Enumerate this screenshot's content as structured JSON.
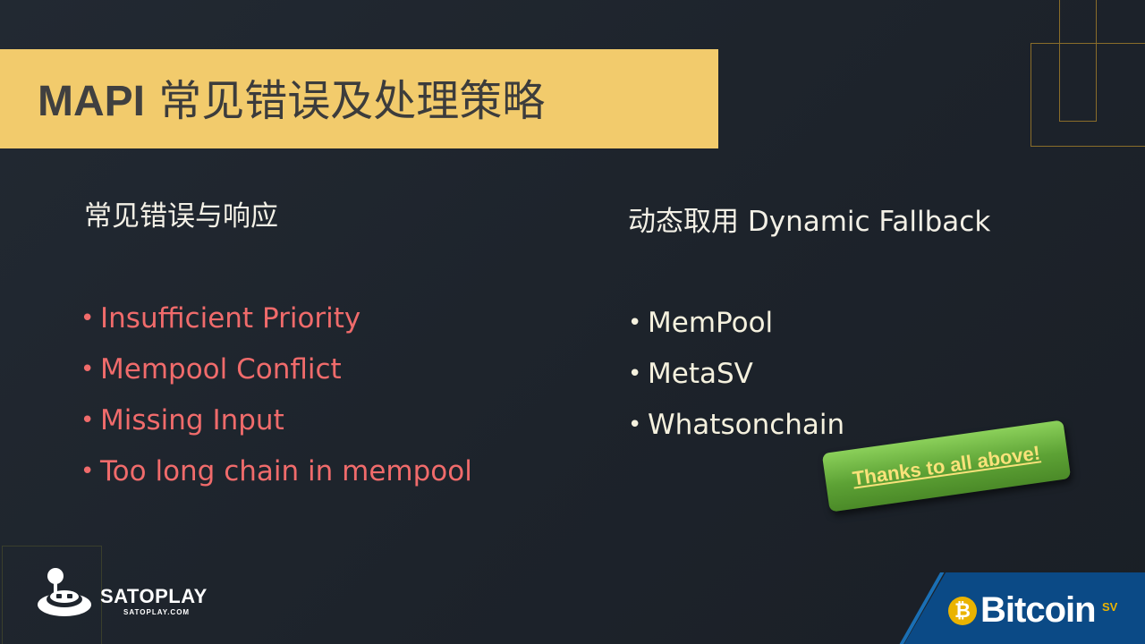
{
  "slide": {
    "title_bold": "MAPI",
    "title_rest": "常见错误及处理策略"
  },
  "left_column": {
    "heading": "常见错误与响应",
    "items": [
      {
        "label": "Insufficient Priority"
      },
      {
        "label": "Mempool Conflict"
      },
      {
        "label": "Missing Input"
      },
      {
        "label": "Too long chain in mempool"
      }
    ]
  },
  "right_column": {
    "heading": "动态取用 Dynamic Fallback",
    "items": [
      {
        "label": "MemPool"
      },
      {
        "label": "MetaSV"
      },
      {
        "label": "Whatsonchain"
      }
    ]
  },
  "badge": {
    "text": "Thanks to all above!"
  },
  "logos": {
    "satoplay_name": "SATOPLAY",
    "satoplay_url": "SATOPLAY.COM",
    "bitcoin_word": "Bitcoin",
    "bitcoin_sup": "SV",
    "bitcoin_coin_glyph": "₿"
  },
  "bullet_glyph": "•",
  "colors": {
    "background": "#1f252d",
    "title_bar": "#f2cb6c",
    "error_text": "#f06b6b",
    "light_text": "#f5f1de",
    "badge_green": "#5da235",
    "badge_text": "#f9e27a",
    "bsv_blue": "#0b4a86",
    "bsv_gold": "#eab300"
  }
}
